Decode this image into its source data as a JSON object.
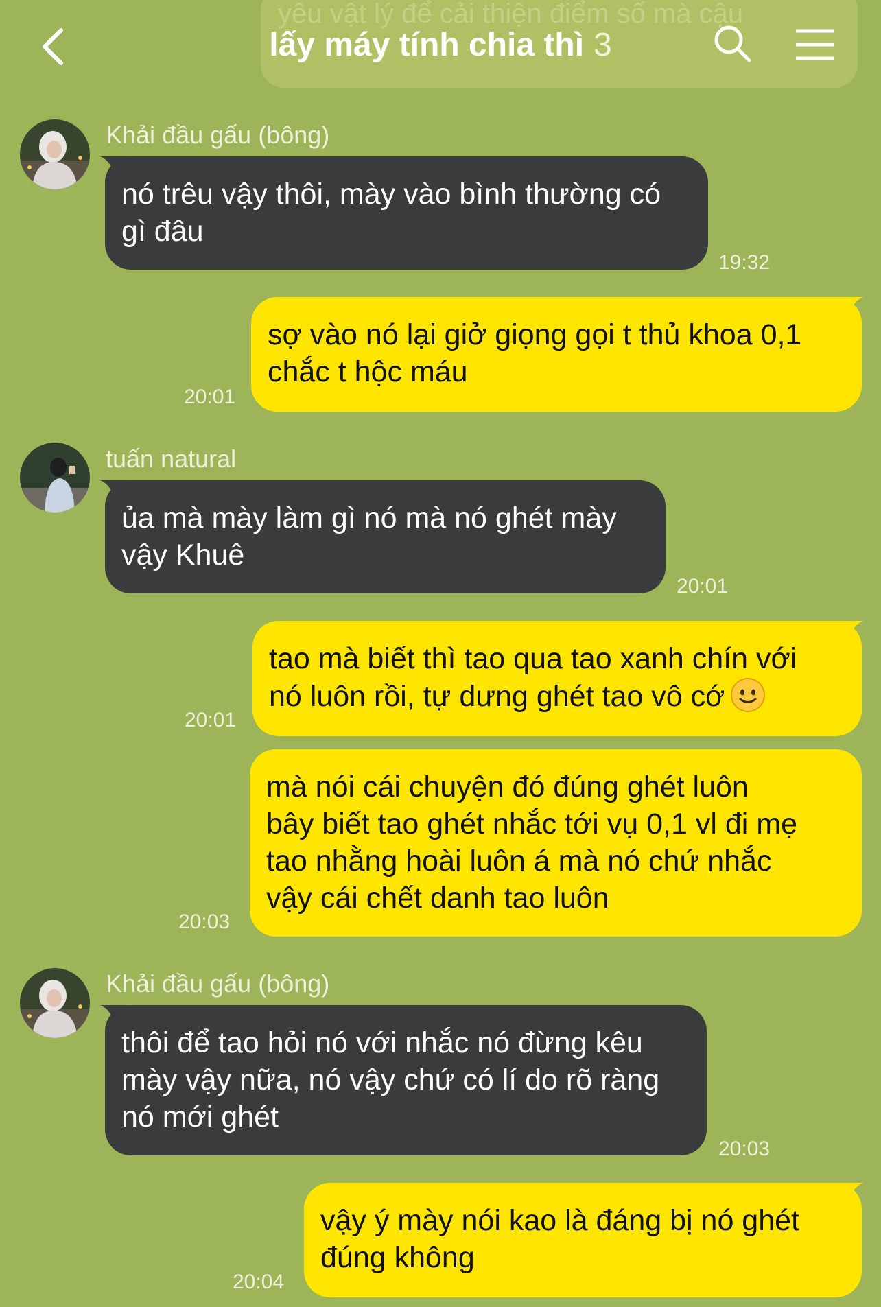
{
  "header": {
    "title": "lấy máy tính chia thì",
    "member_count": "3",
    "behind_text": "yêu vật lý để cải thiện điểm số mà cậu"
  },
  "colors": {
    "background": "#9db458",
    "incoming_bubble": "#3a3b3c",
    "outgoing_bubble": "#ffe500"
  },
  "messages": [
    {
      "direction": "incoming",
      "sender": "Khải đầu gấu (bông)",
      "lines": [
        "nó trêu vậy thôi, mày vào bình thường có",
        "gì đâu"
      ],
      "time": "19:32"
    },
    {
      "direction": "outgoing",
      "lines": [
        "sợ vào nó lại giở giọng gọi t thủ khoa 0,1",
        "chắc t hộc máu"
      ],
      "time": "20:01"
    },
    {
      "direction": "incoming",
      "sender": "tuấn natural",
      "lines": [
        "ủa mà mày làm gì nó mà nó ghét mày",
        "vậy Khuê"
      ],
      "time": "20:01"
    },
    {
      "direction": "outgoing",
      "lines": [
        "tao mà biết thì tao qua tao xanh chín với",
        "nó luôn rồi, tự dưng ghét tao vô cớ"
      ],
      "emoji": "slightly-smiling-face-emoji",
      "time": "20:01"
    },
    {
      "direction": "outgoing",
      "lines": [
        "mà nói cái chuyện đó đúng ghét luôn",
        "bây biết tao ghét nhắc tới vụ 0,1 vl đi mẹ",
        "tao nhằng hoài luôn á mà nó chứ nhắc",
        "vậy cái chết danh tao luôn"
      ],
      "time": "20:03"
    },
    {
      "direction": "incoming",
      "sender": "Khải đầu gấu (bông)",
      "lines": [
        "thôi để tao hỏi nó với nhắc nó đừng kêu",
        "mày vậy nữa, nó vậy chứ có lí do rõ ràng",
        "nó mới ghét"
      ],
      "time": "20:03"
    },
    {
      "direction": "outgoing",
      "lines": [
        "vậy ý mày nói kao là đáng bị nó ghét",
        "đúng không"
      ],
      "time": "20:04"
    }
  ]
}
